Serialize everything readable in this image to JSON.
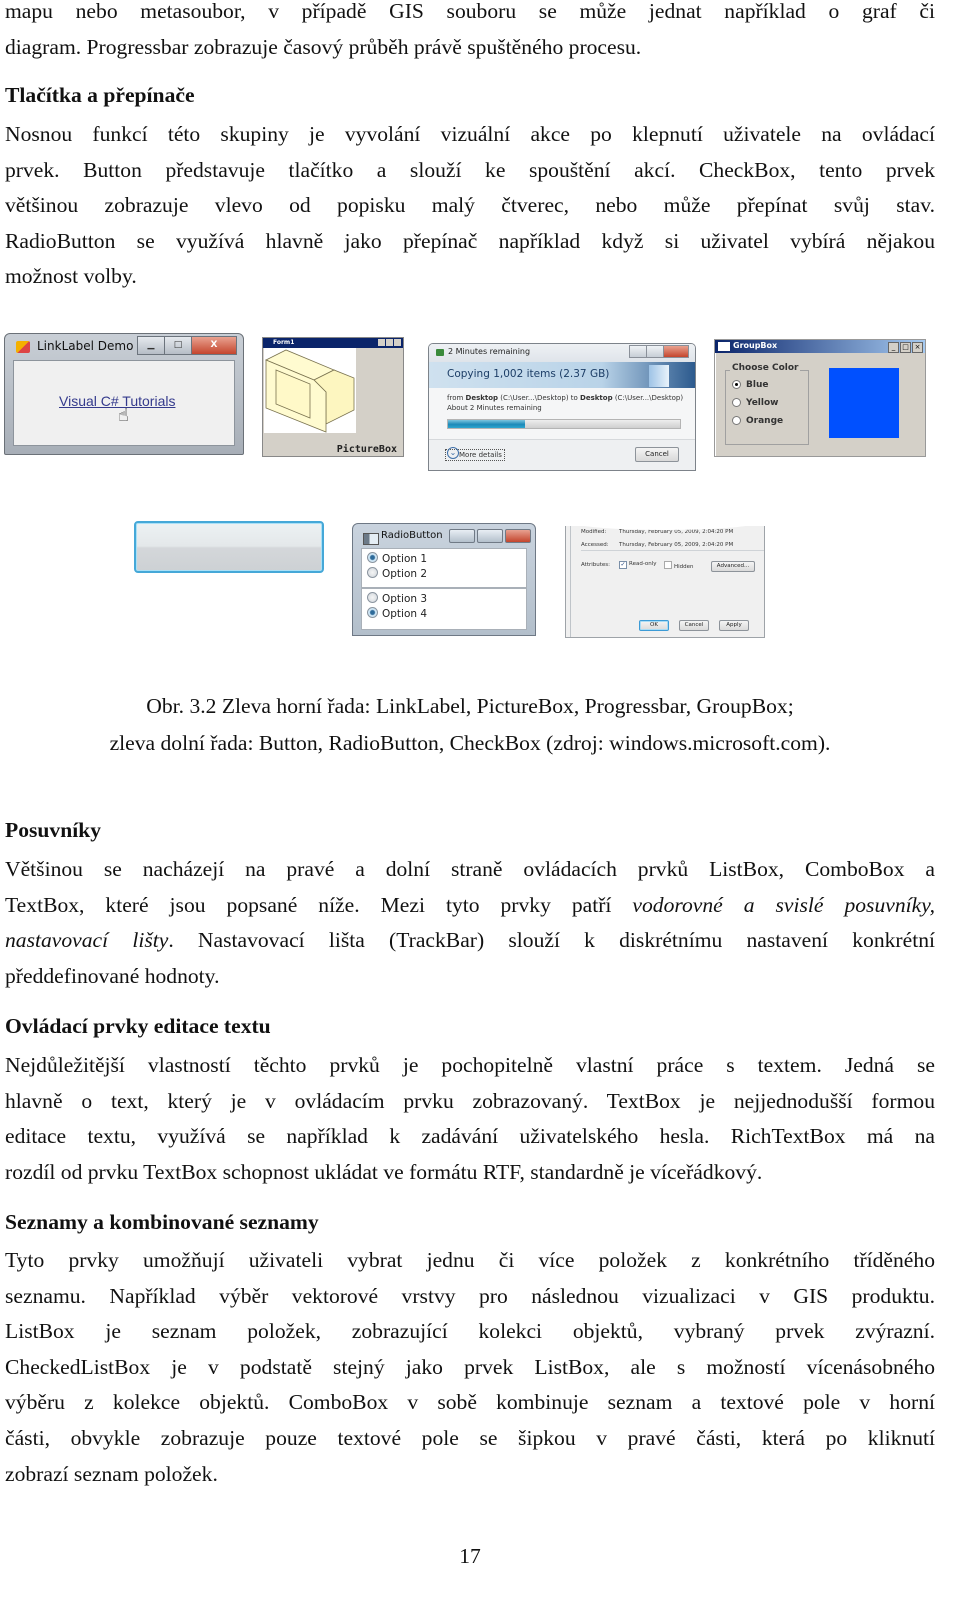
{
  "intro_paragraph": {
    "lines": [
      "mapu nebo metasoubor, v případě GIS souboru se může jednat například o graf či",
      "diagram. Progressbar zobrazuje časový průběh právě spuštěného procesu."
    ]
  },
  "section_buttons": {
    "heading": "Tlačítka a přepínače",
    "lines": [
      "Nosnou funkcí této skupiny je vyvolání vizuální akce po klepnutí uživatele na ovládací",
      "prvek. Button představuje tlačítko a slouží ke spouštění akcí. CheckBox, tento prvek",
      "většinou zobrazuje vlevo od popisku malý čtverec, nebo může přepínat svůj stav.",
      "RadioButton se využívá hlavně jako přepínač například když si uživatel vybírá nějakou",
      "možnost volby."
    ]
  },
  "figure": {
    "linklabel": {
      "window_title": "LinkLabel Demo",
      "link_text": "Visual C# Tutorials",
      "close_glyph": "X"
    },
    "picturebox": {
      "window_title": "Form1",
      "label": "PictureBox"
    },
    "progressbar": {
      "window_title": "2 Minutes remaining",
      "header": "Copying 1,002 items (2.37 GB)",
      "line1_from": "from ",
      "line1_src": "Desktop",
      "line1_src_path": " (C:\\User...\\Desktop) to ",
      "line1_dst": "Desktop",
      "line1_dst_path": " (C:\\User...\\Desktop)",
      "line2": "About 2 Minutes remaining",
      "progress_percent": 33,
      "more_details": "More details",
      "cancel": "Cancel"
    },
    "groupbox": {
      "window_title": "GroupBox",
      "group_label": "Choose Color",
      "options": [
        {
          "label": "Blue",
          "selected": true
        },
        {
          "label": "Yellow",
          "selected": false
        },
        {
          "label": "Orange",
          "selected": false
        }
      ],
      "swatch_color": "#0050ff"
    },
    "radiobutton": {
      "window_title": "RadioButton",
      "group1": [
        {
          "label": "Option 1",
          "selected": true
        },
        {
          "label": "Option 2",
          "selected": false
        }
      ],
      "group2": [
        {
          "label": "Option 3",
          "selected": false
        },
        {
          "label": "Option 4",
          "selected": true
        }
      ]
    },
    "checkbox": {
      "modified_label": "Modified:",
      "modified_value": "Thursday, February 05, 2009, 2:04:20 PM",
      "accessed_label": "Accessed:",
      "accessed_value": "Thursday, February 05, 2009, 2:04:20 PM",
      "attributes_label": "Attributes:",
      "readonly_label": "Read-only",
      "readonly_checked": true,
      "hidden_label": "Hidden",
      "hidden_checked": false,
      "advanced": "Advanced...",
      "ok": "OK",
      "cancel": "Cancel",
      "apply": "Apply"
    },
    "caption_line1": "Obr. 3.2 Zleva horní řada: LinkLabel, PictureBox, Progressbar, GroupBox;",
    "caption_line2": "zleva dolní řada: Button, RadioButton, CheckBox (zdroj: windows.microsoft.com)."
  },
  "section_scrollbars": {
    "heading": "Posuvníky",
    "line1": "Většinou se nacházejí na pravé a dolní straně ovládacích prvků ListBox, ComboBox a",
    "line2_a": "TextBox, které jsou popsané níže. Mezi tyto prvky patří ",
    "line2_em": "vodorovné a svislé posuvníky,",
    "line3_em": "nastavovací lišty",
    "line3_b": ". Nastavovací lišta (TrackBar) slouží k diskrétnímu nastavení konkrétní",
    "line4": "předdefinované hodnoty."
  },
  "section_text_editing": {
    "heading": "Ovládací prvky editace textu",
    "lines": [
      "Nejdůležitější vlastností těchto prvků je pochopitelně vlastní práce s textem. Jedná se",
      "hlavně o text, který je v ovládacím prvku zobrazovaný. TextBox je nejjednodušší formou",
      "editace textu, využívá se například k zadávání uživatelského hesla. RichTextBox má na",
      "rozdíl od prvku TextBox schopnost ukládat ve formátu RTF, standardně je víceřádkový."
    ]
  },
  "section_lists": {
    "heading": "Seznamy a kombinované seznamy",
    "lines": [
      "Tyto prvky umožňují uživateli vybrat jednu či více položek z konkrétního tříděného",
      "seznamu. Například výběr vektorové vrstvy pro následnou vizualizaci v GIS produktu.",
      "ListBox je seznam položek, zobrazující kolekci objektů, vybraný prvek zvýrazní.",
      "CheckedListBox je v podstatě stejný jako prvek ListBox, ale s možností vícenásobného",
      "výběru z kolekce objektů. ComboBox v sobě kombinuje seznam a textové pole v horní",
      "části, obvykle zobrazuje pouze textové pole se šipkou v pravé části, která po kliknutí",
      "zobrazí seznam položek."
    ]
  },
  "page_number": "17"
}
